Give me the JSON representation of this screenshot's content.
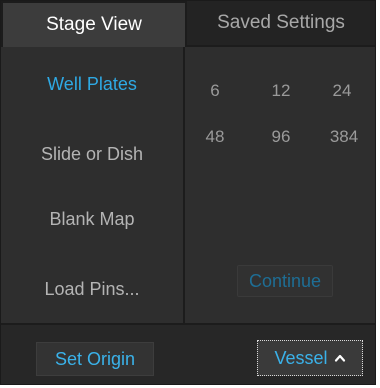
{
  "tabs": {
    "stage_view": "Stage View",
    "saved_settings": "Saved Settings"
  },
  "menu": {
    "items": [
      {
        "label": "Well Plates",
        "selected": true
      },
      {
        "label": "Slide or Dish",
        "selected": false
      },
      {
        "label": "Blank Map",
        "selected": false
      },
      {
        "label": "Load Pins...",
        "selected": false
      }
    ]
  },
  "plate_options": [
    "6",
    "12",
    "24",
    "48",
    "96",
    "384"
  ],
  "continue_label": "Continue",
  "footer": {
    "set_origin_label": "Set Origin",
    "vessel_label": "Vessel",
    "vessel_icon": "chevron-up-icon"
  },
  "colors": {
    "accent": "#2ea9e4",
    "panel_bg": "#2e2e2e",
    "active_tab_bg": "#3c3c3c",
    "muted_text": "#b4b4b4",
    "disabled_accent": "#1e6e95"
  }
}
